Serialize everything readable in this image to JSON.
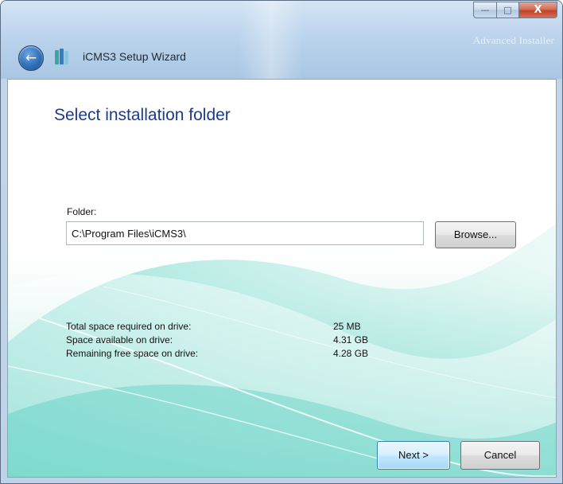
{
  "window": {
    "title": "iCMS3 Setup Wizard",
    "brand": "Advanced Installer",
    "buttons": {
      "minimize": "—",
      "maximize": "□",
      "close": "X"
    }
  },
  "page": {
    "heading": "Select installation folder",
    "folder": {
      "label": "Folder:",
      "value": "C:\\Program Files\\iCMS3\\",
      "browse_label": "Browse..."
    },
    "space_info": [
      {
        "label": "Total space required on drive:",
        "value": "25 MB"
      },
      {
        "label": "Space available on drive:",
        "value": "4.31 GB"
      },
      {
        "label": "Remaining free space on drive:",
        "value": "4.28 GB"
      }
    ]
  },
  "footer": {
    "next_label": "Next >",
    "cancel_label": "Cancel"
  },
  "colors": {
    "heading": "#1e3a8a",
    "accent_teal": "#2fc4b2",
    "titlebar": "#bcd4ec"
  },
  "icons": {
    "back": "back-arrow-icon",
    "app": "installer-app-icon"
  }
}
